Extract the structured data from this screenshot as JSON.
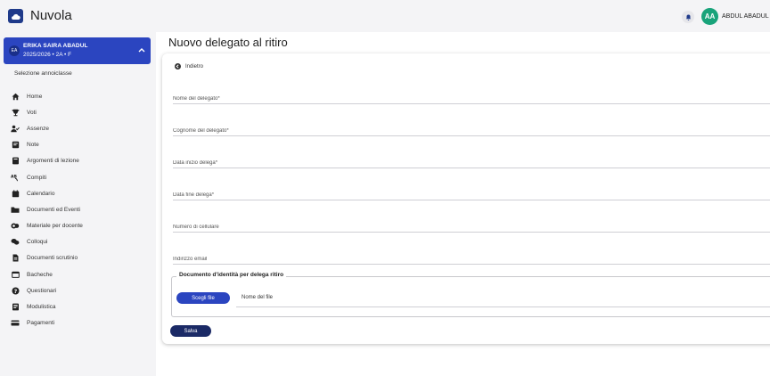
{
  "app": {
    "title": "Nuvola"
  },
  "user": {
    "initials": "AA",
    "name": "ABDUL ABADUL ▾"
  },
  "student": {
    "initials": "EA",
    "name": "ERIKA SAIRA ABADUL",
    "class": "2025/2026 • 2A • F"
  },
  "sidebar": {
    "year_select": "Selezione annoiclasse",
    "items": [
      {
        "label": "Home",
        "icon": "home-icon"
      },
      {
        "label": "Voti",
        "icon": "trophy-icon"
      },
      {
        "label": "Assenze",
        "icon": "person-check-icon"
      },
      {
        "label": "Note",
        "icon": "note-icon"
      },
      {
        "label": "Argomenti di lezione",
        "icon": "book-icon"
      },
      {
        "label": "Compiti",
        "icon": "homework-icon"
      },
      {
        "label": "Calendario",
        "icon": "calendar-icon"
      },
      {
        "label": "Documenti ed Eventi",
        "icon": "folder-icon"
      },
      {
        "label": "Materiale per docente",
        "icon": "share-icon"
      },
      {
        "label": "Colloqui",
        "icon": "chat-icon"
      },
      {
        "label": "Documenti scrutinio",
        "icon": "document-icon"
      },
      {
        "label": "Bacheche",
        "icon": "board-icon"
      },
      {
        "label": "Questionari",
        "icon": "question-icon"
      },
      {
        "label": "Modulistica",
        "icon": "forms-icon"
      },
      {
        "label": "Pagamenti",
        "icon": "payment-icon"
      }
    ]
  },
  "main": {
    "title": "Nuovo delegato al ritiro",
    "back_label": "Indietro",
    "fields": [
      {
        "placeholder": "Nome del delegato*",
        "value": ""
      },
      {
        "placeholder": "Cognome del delegato*",
        "value": ""
      },
      {
        "placeholder": "Data inizio delega*",
        "value": ""
      },
      {
        "placeholder": "Data fine delega*",
        "value": ""
      },
      {
        "placeholder": "Numero di cellulare",
        "value": ""
      },
      {
        "placeholder": "Indirizzo email",
        "value": ""
      }
    ],
    "document": {
      "legend": "Documento d'identità per delega ritiro",
      "choose_label": "Scegli file",
      "file_name": "Nome del file"
    },
    "save_label": "Salva"
  },
  "colors": {
    "primary": "#2b45c0",
    "dark_button": "#1b2a66",
    "avatar": "#18a37a",
    "sidebar_bg": "#f4f4f6"
  }
}
